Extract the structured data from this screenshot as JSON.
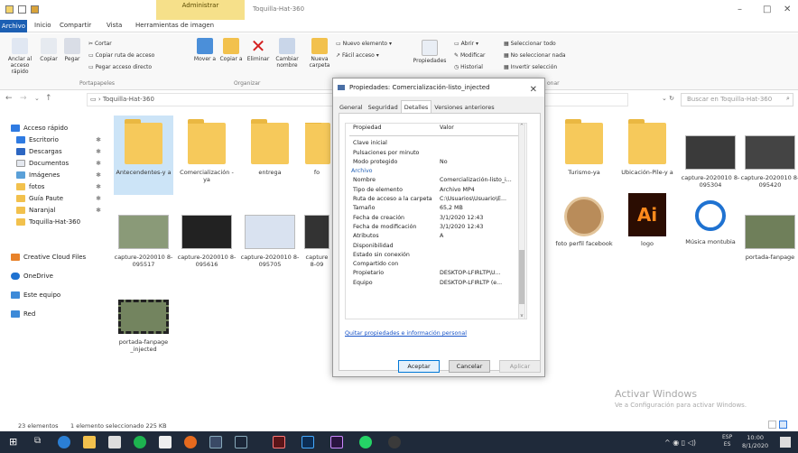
{
  "window": {
    "contextual_tab": "Administrar",
    "title": "Toquilla-Hat-360",
    "minimize": "–",
    "maximize": "□",
    "close": "✕"
  },
  "tabs": {
    "file": "Archivo",
    "items": [
      "Inicio",
      "Compartir",
      "Vista",
      "Herramientas de imagen"
    ]
  },
  "ribbon": {
    "clipboard": {
      "pin": "Anclar al acceso rápido",
      "copy": "Copiar",
      "paste": "Pegar",
      "cut": "Cortar",
      "copy_path": "Copiar ruta de acceso",
      "paste_shortcut": "Pegar acceso directo",
      "group": "Portapapeles"
    },
    "organize": {
      "move": "Mover a",
      "copy": "Copiar a",
      "delete": "Eliminar",
      "rename": "Cambiar nombre",
      "group": "Organizar"
    },
    "new": {
      "folder": "Nueva carpeta",
      "new_item": "Nuevo elemento",
      "easy_access": "Fácil acceso"
    },
    "open": {
      "properties": "Propiedades",
      "open": "Abrir",
      "modify": "Modificar",
      "history": "Historial"
    },
    "select": {
      "select_all": "Seleccionar todo",
      "select_none": "No seleccionar nada",
      "invert": "Invertir selección",
      "group": "onar"
    }
  },
  "address": {
    "path": "Toquilla-Hat-360",
    "search_placeholder": "Buscar en Toquilla-Hat-360"
  },
  "nav": {
    "quick_access": "Acceso rápido",
    "items": [
      "Escritorio",
      "Descargas",
      "Documentos",
      "Imágenes",
      "fotos",
      "Guía Paute",
      "Naranjal",
      "Toquilla-Hat-360"
    ],
    "others": [
      "Creative Cloud Files",
      "OneDrive",
      "Este equipo",
      "Red"
    ]
  },
  "files": [
    {
      "name": "Antecendentes-y a",
      "kind": "folder"
    },
    {
      "name": "Comercialización -ya",
      "kind": "folder"
    },
    {
      "name": "entrega",
      "kind": "folder"
    },
    {
      "name": "fo",
      "kind": "folder"
    },
    {
      "name": "Turismo-ya",
      "kind": "folder"
    },
    {
      "name": "Ubicación-Pile-y a",
      "kind": "folder"
    },
    {
      "name": "capture-2020010 8-095304",
      "kind": "image"
    },
    {
      "name": "capture-2020010 8-095420",
      "kind": "image"
    },
    {
      "name": "capture-2020010 8-095517",
      "kind": "image"
    },
    {
      "name": "capture-2020010 8-095616",
      "kind": "image"
    },
    {
      "name": "capture-2020010 8-095705",
      "kind": "image"
    },
    {
      "name": "capture 8-09",
      "kind": "image"
    },
    {
      "name": "foto perfil facebook",
      "kind": "image"
    },
    {
      "name": "logo",
      "kind": "ai"
    },
    {
      "name": "Música montubia",
      "kind": "audio"
    },
    {
      "name": "portada-fanpage",
      "kind": "image"
    },
    {
      "name": "portada-fanpage _injected",
      "kind": "video"
    }
  ],
  "status": {
    "count": "23 elementos",
    "selection": "1 elemento seleccionado 225 KB"
  },
  "dialog": {
    "title": "Propiedades: Comercialización-listo_injected",
    "tabs": [
      "General",
      "Seguridad",
      "Detalles",
      "Versiones anteriores"
    ],
    "header_prop": "Propiedad",
    "header_val": "Valor",
    "rows": [
      {
        "k": "Clave inicial",
        "v": ""
      },
      {
        "k": "Pulsaciones por minuto",
        "v": ""
      },
      {
        "k": "Modo protegido",
        "v": "No"
      }
    ],
    "section": "Archivo",
    "file_rows": [
      {
        "k": "Nombre",
        "v": "Comercialización-listo_i..."
      },
      {
        "k": "Tipo de elemento",
        "v": "Archivo MP4"
      },
      {
        "k": "Ruta de acceso a la carpeta",
        "v": "C:\\Usuarios\\Usuario\\E..."
      },
      {
        "k": "Tamaño",
        "v": "65,2 MB"
      },
      {
        "k": "Fecha de creación",
        "v": "3/1/2020 12:43"
      },
      {
        "k": "Fecha de modificación",
        "v": "3/1/2020 12:43"
      },
      {
        "k": "Atributos",
        "v": "A"
      },
      {
        "k": "Disponibilidad",
        "v": ""
      },
      {
        "k": "Estado sin conexión",
        "v": ""
      },
      {
        "k": "Compartido con",
        "v": ""
      },
      {
        "k": "Propietario",
        "v": "DESKTOP-LFIRLTP\\U..."
      },
      {
        "k": "Equipo",
        "v": "DESKTOP-LFIRLTP (e..."
      }
    ],
    "link": "Quitar propiedades e información personal",
    "ok": "Aceptar",
    "cancel": "Cancelar",
    "apply": "Aplicar"
  },
  "watermark": {
    "line1": "Activar Windows",
    "line2": "Ve a Configuración para activar Windows."
  },
  "taskbar": {
    "lang1": "ESP",
    "lang2": "ES",
    "time": "10:00",
    "date": "8/1/2020"
  }
}
